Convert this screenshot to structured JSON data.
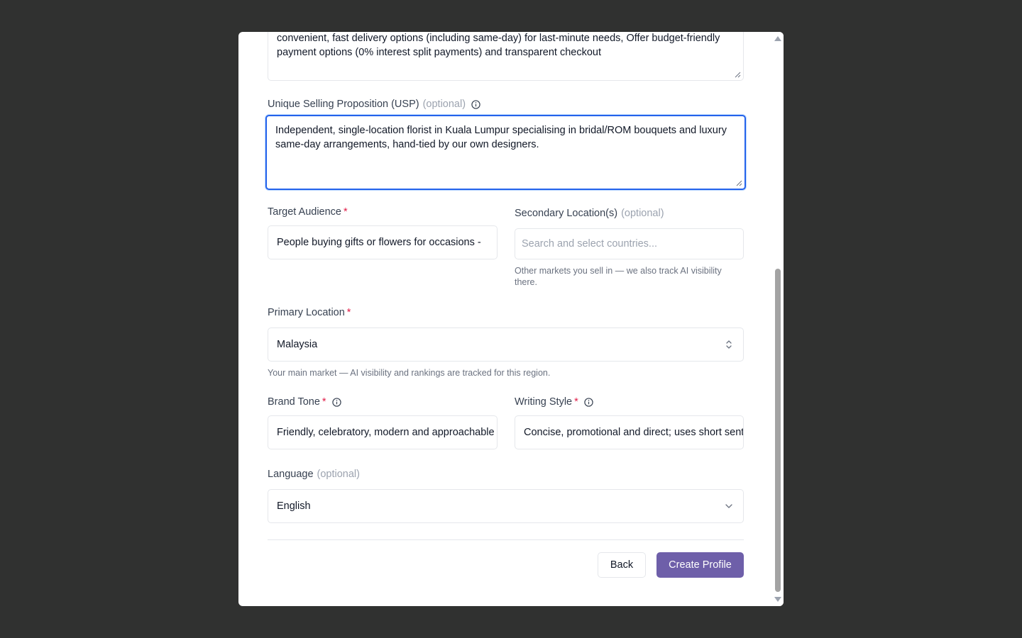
{
  "form": {
    "top_textarea_text": "convenient, fast delivery options (including same-day) for last-minute needs, Offer budget-friendly payment options (0% interest split payments) and transparent checkout",
    "usp": {
      "label": "Unique Selling Proposition (USP)",
      "optional": "(optional)",
      "value": "Independent, single-location florist in Kuala Lumpur specialising in bridal/ROM bouquets and luxury same-day arrangements, hand-tied by our own designers."
    },
    "target_audience": {
      "label": "Target Audience",
      "required": "*",
      "value": "People buying gifts or flowers for occasions - "
    },
    "secondary_locations": {
      "label": "Secondary Location(s)",
      "optional": "(optional)",
      "placeholder": "Search and select countries...",
      "help": "Other markets you sell in — we also track AI visibility there."
    },
    "primary_location": {
      "label": "Primary Location",
      "required": "*",
      "value": "Malaysia",
      "help": "Your main market — AI visibility and rankings are tracked for this region."
    },
    "brand_tone": {
      "label": "Brand Tone",
      "required": "*",
      "value": "Friendly, celebratory, modern and approachable"
    },
    "writing_style": {
      "label": "Writing Style",
      "required": "*",
      "value": "Concise, promotional and direct; uses short sentences"
    },
    "language": {
      "label": "Language",
      "optional": "(optional)",
      "value": "English"
    }
  },
  "actions": {
    "back_label": "Back",
    "create_label": "Create Profile"
  },
  "icons": {
    "info": "info-circle-icon",
    "select": "chevron-up-down-icon",
    "dropdown": "chevron-down-icon"
  },
  "colors": {
    "primary_button": "#6e5fa9",
    "focus_ring": "#2563eb",
    "required": "#e11d48",
    "backdrop": "#303130"
  }
}
